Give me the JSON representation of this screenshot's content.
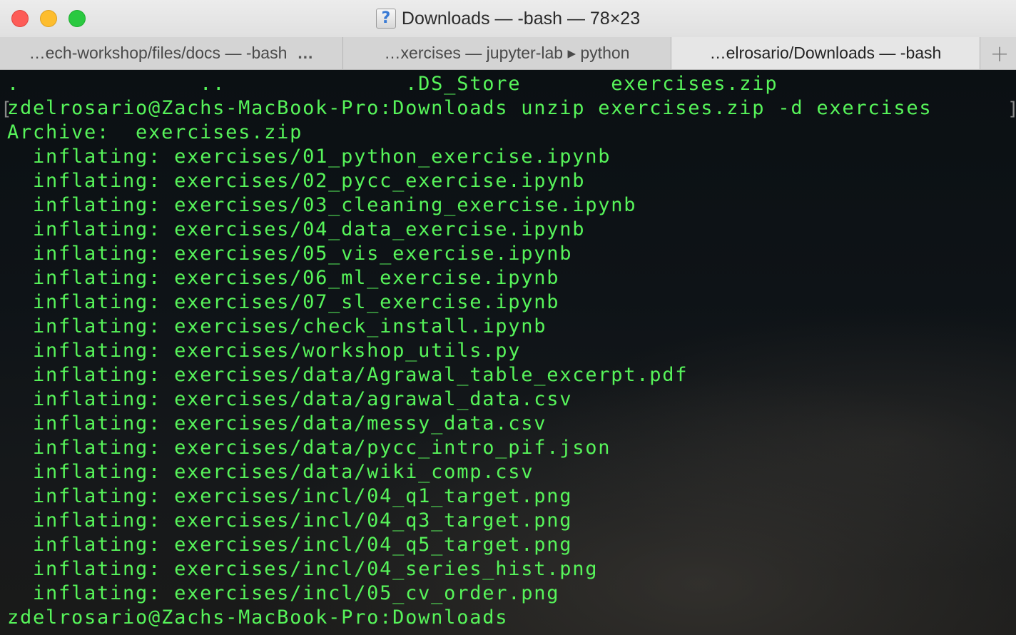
{
  "window": {
    "title": "Downloads — -bash — 78×23",
    "title_icon": "question-document-icon"
  },
  "tabs": [
    {
      "label": "…ech-workshop/files/docs — -bash",
      "extra": "…"
    },
    {
      "label": "…xercises — jupyter-lab ▸ python"
    },
    {
      "label": "…elrosario/Downloads — -bash"
    }
  ],
  "new_tab_label": "+",
  "terminal": {
    "lines": [
      ".              ..              .DS_Store       exercises.zip",
      "zdelrosario@Zachs-MacBook-Pro:Downloads unzip exercises.zip -d exercises",
      "Archive:  exercises.zip",
      "  inflating: exercises/01_python_exercise.ipynb",
      "  inflating: exercises/02_pycc_exercise.ipynb",
      "  inflating: exercises/03_cleaning_exercise.ipynb",
      "  inflating: exercises/04_data_exercise.ipynb",
      "  inflating: exercises/05_vis_exercise.ipynb",
      "  inflating: exercises/06_ml_exercise.ipynb",
      "  inflating: exercises/07_sl_exercise.ipynb",
      "  inflating: exercises/check_install.ipynb",
      "  inflating: exercises/workshop_utils.py",
      "  inflating: exercises/data/Agrawal_table_excerpt.pdf",
      "  inflating: exercises/data/agrawal_data.csv",
      "  inflating: exercises/data/messy_data.csv",
      "  inflating: exercises/data/pycc_intro_pif.json",
      "  inflating: exercises/data/wiki_comp.csv",
      "  inflating: exercises/incl/04_q1_target.png",
      "  inflating: exercises/incl/04_q3_target.png",
      "  inflating: exercises/incl/04_q5_target.png",
      "  inflating: exercises/incl/04_series_hist.png",
      "  inflating: exercises/incl/05_cv_order.png",
      "zdelrosario@Zachs-MacBook-Pro:Downloads "
    ],
    "text_color": "#57f45a"
  },
  "colors": {
    "close": "#fd5c57",
    "minimize": "#fdbd2e",
    "maximize": "#2ac940"
  }
}
